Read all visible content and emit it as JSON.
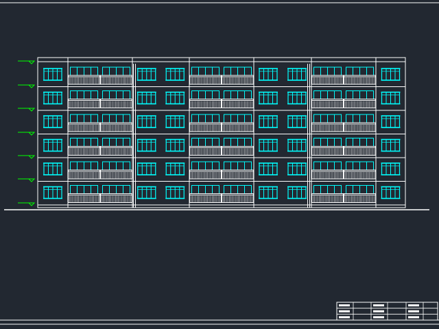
{
  "drawing": {
    "background": "#222831",
    "line_color": "#ffffff",
    "window_color": "#00ffff",
    "marker_color": "#00ff00",
    "floors": 6,
    "bays": 12,
    "bay_types": [
      "plain",
      "balcony",
      "balcony",
      "plain",
      "plain",
      "balcony",
      "balcony",
      "plain",
      "plain",
      "balcony",
      "balcony",
      "plain"
    ],
    "title_block": {
      "rows": 3,
      "columns": 6,
      "text": []
    }
  }
}
